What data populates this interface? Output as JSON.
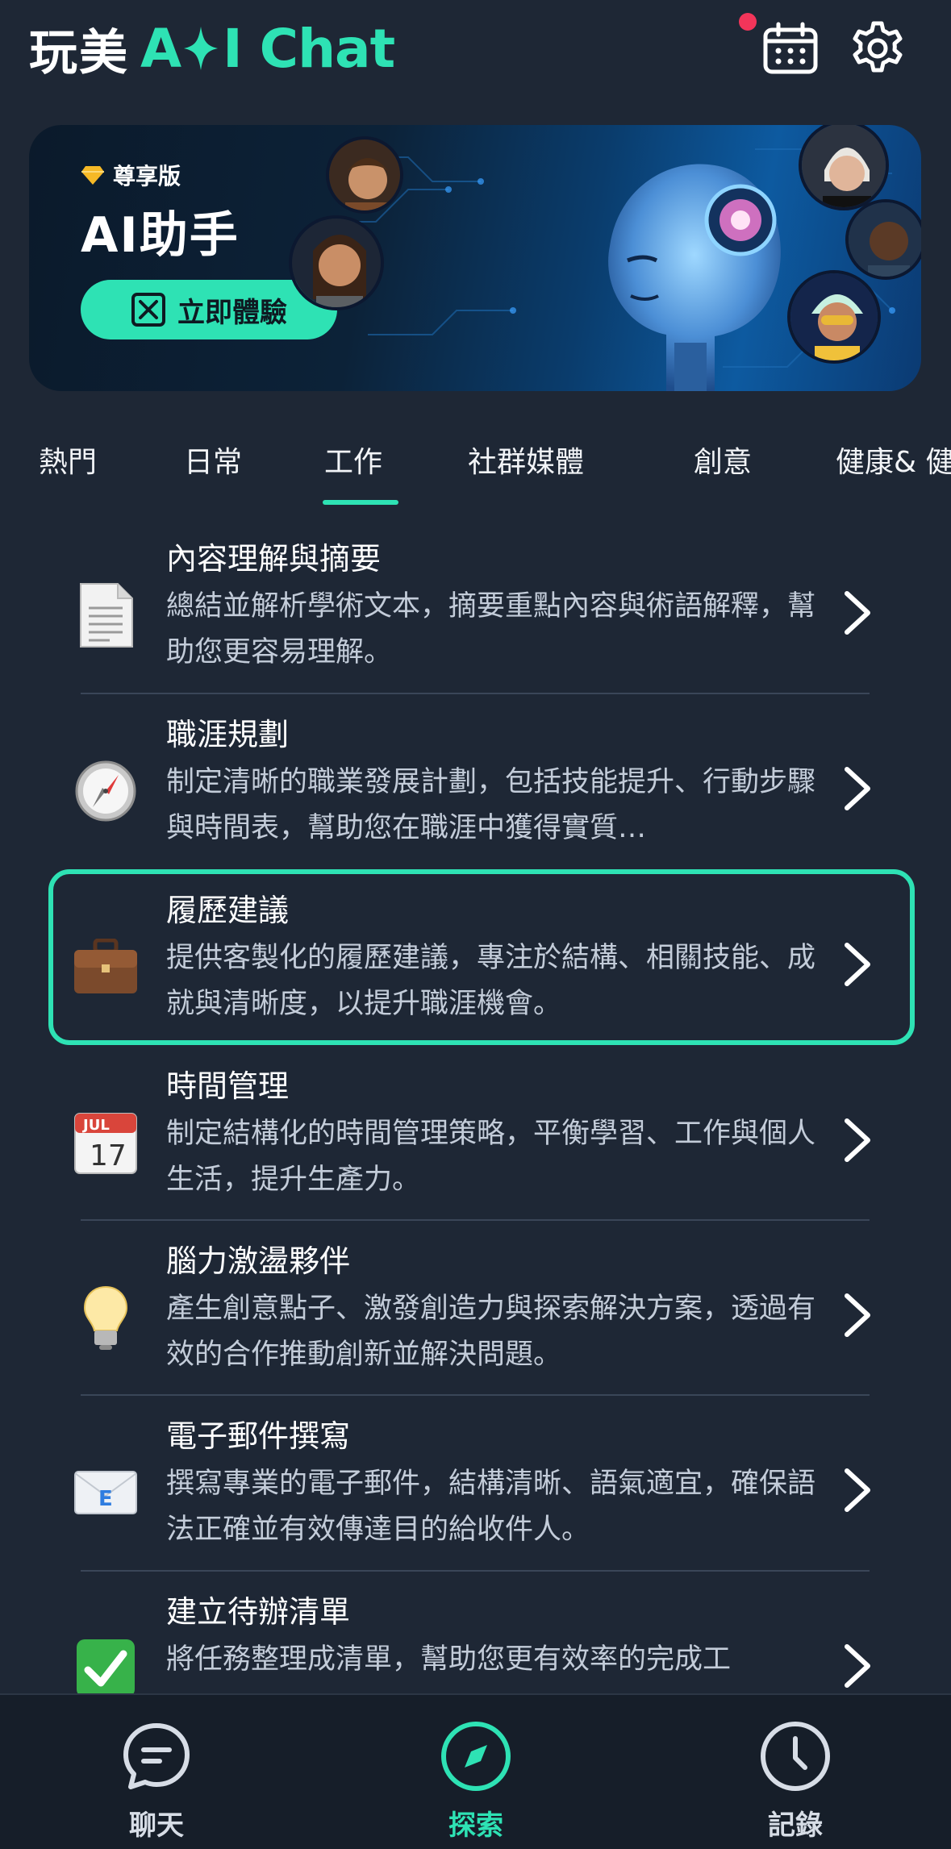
{
  "header": {
    "logo_cn": "玩美",
    "logo_ai_left": "A",
    "logo_ai_right": "I Chat",
    "calendar_icon": "calendar-icon",
    "settings_icon": "gear-icon",
    "notification_dot_color": "#f2355a"
  },
  "banner": {
    "badge": "尊享版",
    "title": "AI助手",
    "cta": "立即體驗",
    "accent_color": "#2ee2b4"
  },
  "tabs": [
    {
      "label": "熱門"
    },
    {
      "label": "日常"
    },
    {
      "label": "工作",
      "active": true
    },
    {
      "label": "社群媒體"
    },
    {
      "label": "創意"
    },
    {
      "label": "健康& 健"
    }
  ],
  "items": [
    {
      "title": "內容理解與摘要",
      "desc": "總結並解析學術文本，摘要重點內容與術語解釋，幫助您更容易理解。",
      "icon": "document-icon"
    },
    {
      "title": "職涯規劃",
      "desc": "制定清晰的職業發展計劃，包括技能提升、行動步驟與時間表，幫助您在職涯中獲得實質…",
      "icon": "compass-icon"
    },
    {
      "title": "履歷建議",
      "desc": "提供客製化的履歷建議，專注於結構、相關技能、成就與清晰度，以提升職涯機會。",
      "icon": "briefcase-icon",
      "selected": true
    },
    {
      "title": "時間管理",
      "desc": "制定結構化的時間管理策略，平衡學習、工作與個人生活，提升生產力。",
      "icon": "calendar-date-icon",
      "icon_month": "JUL",
      "icon_day": "17"
    },
    {
      "title": "腦力激盪夥伴",
      "desc": "產生創意點子、激發創造力與探索解決方案，透過有效的合作推動創新並解決問題。",
      "icon": "lightbulb-icon"
    },
    {
      "title": "電子郵件撰寫",
      "desc": "撰寫專業的電子郵件，結構清晰、語氣適宜，確保語法正確並有效傳達目的給收件人。",
      "icon": "email-icon",
      "icon_letter": "E"
    },
    {
      "title": "建立待辦清單",
      "desc": "將任務整理成清單，幫助您更有效率的完成工",
      "icon": "checkmark-icon"
    }
  ],
  "bottom_nav": [
    {
      "label": "聊天",
      "icon": "chat-icon"
    },
    {
      "label": "探索",
      "icon": "compass-icon",
      "active": true
    },
    {
      "label": "記錄",
      "icon": "clock-icon"
    }
  ]
}
